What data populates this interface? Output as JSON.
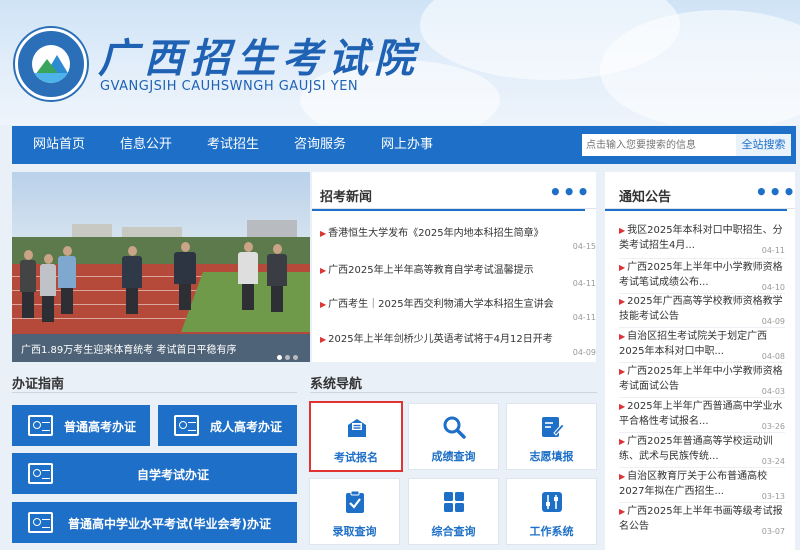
{
  "header": {
    "site_title": "广西招生考试院",
    "site_subtitle": "GVANGJSIH CAUHSWNGH GAUJSI YEN",
    "logo_text": "广西招生考试院",
    "logo_ring_text": "GVANGJSIH CAUHSWNGH GAUJSI YEN"
  },
  "nav": {
    "items": [
      "网站首页",
      "信息公开",
      "考试招生",
      "咨询服务",
      "网上办事"
    ],
    "search_placeholder": "点击输入您要搜索的信息",
    "search_button": "全站搜索"
  },
  "slider": {
    "caption": "广西1.89万考生迎来体育统考 考试首日平稳有序",
    "dots": 3,
    "active_dot": 0
  },
  "news": {
    "title": "招考新闻",
    "more": "•••",
    "items": [
      {
        "title": "香港恒生大学发布《2025年内地本科招生简章》",
        "date": "04-15"
      },
      {
        "title": "广西2025年上半年高等教育自学考试温馨提示",
        "date": "04-11"
      },
      {
        "title": "广西考生｜2025年西交利物浦大学本科招生宣讲会",
        "date": "04-11"
      },
      {
        "title": "2025年上半年剑桥少儿英语考试将于4月12日开考",
        "date": "04-09"
      }
    ]
  },
  "notice": {
    "title": "通知公告",
    "more": "•••",
    "items": [
      {
        "line1": "我区2025年本科对口中职招生、分",
        "line2": "类考试招生4月...",
        "date": "04-11"
      },
      {
        "line1": "广西2025年上半年中小学教师资格",
        "line2": "考试笔试成绩公布...",
        "date": "04-10"
      },
      {
        "line1": "2025年广西高等学校教师资格教学",
        "line2": "技能考试公告",
        "date": "04-09"
      },
      {
        "line1": "自治区招生考试院关于划定广西",
        "line2": "2025年本科对口中职...",
        "date": "04-08"
      },
      {
        "line1": "广西2025年上半年中小学教师资格",
        "line2": "考试面试公告",
        "date": "04-03"
      },
      {
        "line1": "2025年上半年广西普通高中学业水",
        "line2": "平合格性考试报名...",
        "date": "03-26"
      },
      {
        "line1": "广西2025年普通高等学校运动训",
        "line2": "练、武术与民族传统...",
        "date": "03-24"
      },
      {
        "line1": "自治区教育厅关于公布普通高校",
        "line2": "2027年拟在广西招生...",
        "date": "03-13"
      },
      {
        "line1": "广西2025年上半年书画等级考试报",
        "line2": "名公告",
        "date": "03-07"
      }
    ]
  },
  "certificates": {
    "title": "办证指南",
    "buttons": [
      "普通高考办证",
      "成人高考办证",
      "自学考试办证",
      "普通高中学业水平考试(毕业会考)办证"
    ]
  },
  "system_nav": {
    "title": "系统导航",
    "tiles": [
      "考试报名",
      "成绩查询",
      "志愿填报",
      "录取查询",
      "综合查询",
      "工作系统"
    ]
  },
  "colors": {
    "primary": "#1d6fc7",
    "highlight": "#e23333",
    "background": "#e9f0f8"
  }
}
